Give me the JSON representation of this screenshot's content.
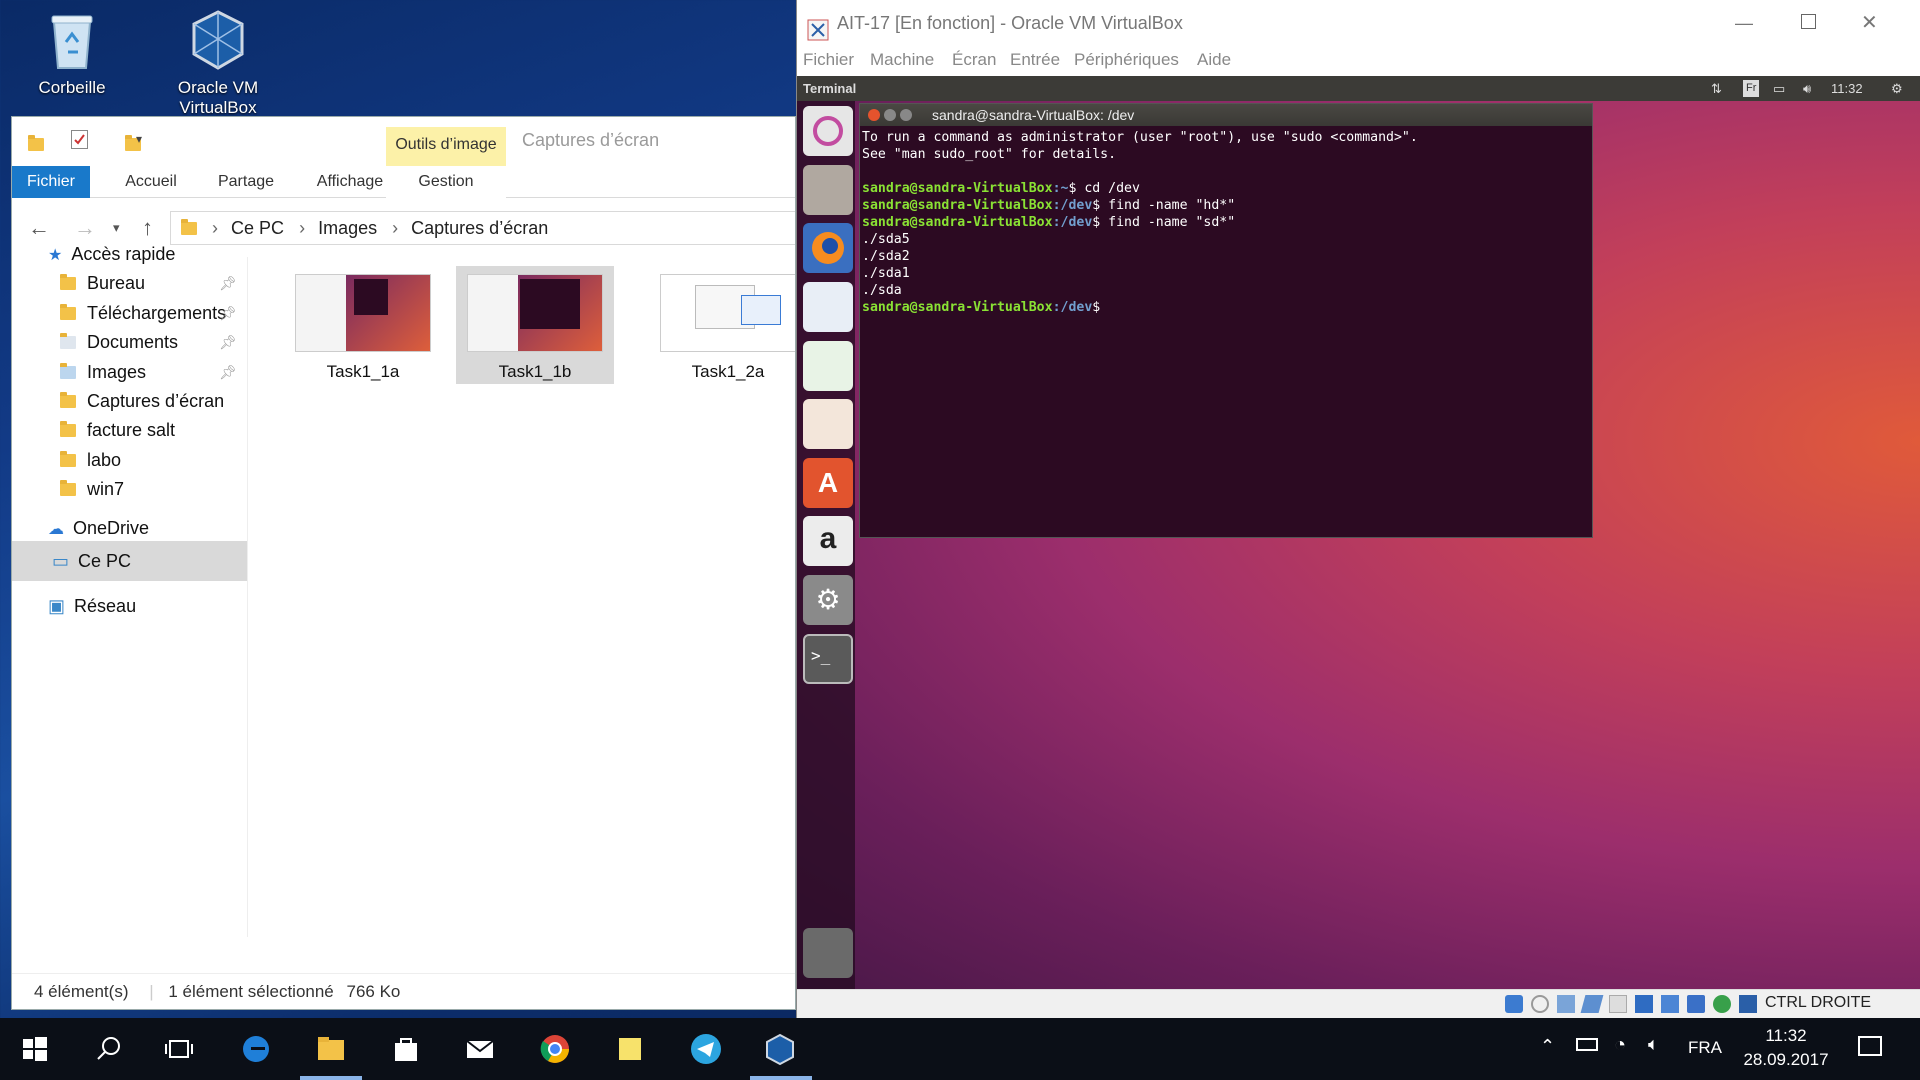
{
  "desktop": {
    "icons": [
      {
        "label": "Corbeille"
      },
      {
        "label": "Oracle VM VirtualBox"
      }
    ]
  },
  "explorer": {
    "contextual_tab": "Outils d’image",
    "window_title": "Captures d’écran",
    "tabs": [
      "Fichier",
      "Accueil",
      "Partage",
      "Affichage",
      "Gestion"
    ],
    "breadcrumb": [
      "Ce PC",
      "Images",
      "Captures d’écran"
    ],
    "tree": {
      "quick_access": "Accès rapide",
      "items": [
        "Bureau",
        "Téléchargements",
        "Documents",
        "Images",
        "Captures d’écran",
        "facture salt",
        "labo",
        "win7"
      ],
      "onedrive": "OneDrive",
      "this_pc": "Ce PC",
      "network": "Réseau"
    },
    "files": [
      "Task1_1a",
      "Task1_1b",
      "Task1_2a"
    ],
    "status": {
      "count": "4 élément(s)",
      "selected": "1 élément sélectionné",
      "size": "766 Ko"
    }
  },
  "vbox": {
    "title": "AIT-17 [En fonction] - Oracle VM VirtualBox",
    "menu": [
      "Fichier",
      "Machine",
      "Écran",
      "Entrée",
      "Périphériques",
      "Aide"
    ],
    "host_key": "CTRL DROITE",
    "ubuntu": {
      "panel_title": "Terminal",
      "keyboard": "Fr",
      "time": "11:32",
      "terminal": {
        "title": "sandra@sandra-VirtualBox: /dev",
        "line1": "To run a command as administrator (user \"root\"), use \"sudo <command>\".",
        "line2": "See \"man sudo_root\" for details.",
        "p1_user": "sandra@sandra-VirtualBox",
        "p1_path": ":~",
        "p1_cmd": "$ cd /dev",
        "p2_path": ":/dev",
        "p2_cmd": "$ find -name \"hd*\"",
        "p3_cmd": "$ find -name \"sd*\"",
        "out1": "./sda5",
        "out2": "./sda2",
        "out3": "./sda1",
        "out4": "./sda",
        "p4_cmd": "$"
      }
    }
  },
  "taskbar": {
    "lang": "FRA",
    "time": "11:32",
    "date": "28.09.2017"
  }
}
